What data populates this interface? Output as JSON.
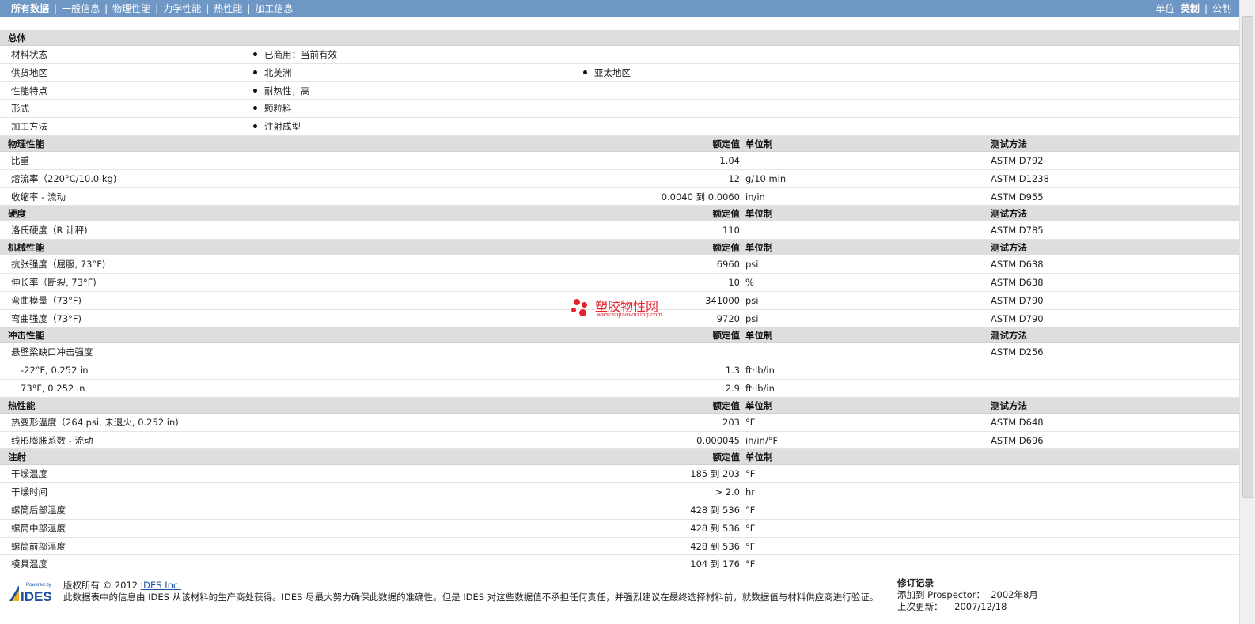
{
  "nav": {
    "tabs": [
      "所有数据",
      "一般信息",
      "物理性能",
      "力学性能",
      "热性能",
      "加工信息"
    ],
    "units_label": "单位",
    "unit_english": "英制",
    "unit_metric": "公制"
  },
  "headers": {
    "rated": "额定值",
    "unit": "单位制",
    "test": "测试方法"
  },
  "general": {
    "title": "总体",
    "rows": [
      {
        "name": "材料状态",
        "values": [
          "已商用：当前有效"
        ]
      },
      {
        "name": "供货地区",
        "values": [
          "北美洲",
          "亚太地区"
        ]
      },
      {
        "name": "性能特点",
        "values": [
          "耐热性，高"
        ]
      },
      {
        "name": "形式",
        "values": [
          "颗粒料"
        ]
      },
      {
        "name": "加工方法",
        "values": [
          "注射成型"
        ]
      }
    ]
  },
  "physical": {
    "title": "物理性能",
    "rows": [
      {
        "name": "比重",
        "value": "1.04",
        "unit": "",
        "test": "ASTM D792"
      },
      {
        "name": "熔流率（220°C/10.0 kg)",
        "value": "12",
        "unit": "g/10 min",
        "test": "ASTM D1238"
      },
      {
        "name": "收缩率 - 流动",
        "value": "0.0040 到  0.0060",
        "unit": "in/in",
        "test": "ASTM D955"
      }
    ]
  },
  "hardness": {
    "title": "硬度",
    "rows": [
      {
        "name": "洛氏硬度（R 计秤)",
        "value": "110",
        "unit": "",
        "test": "ASTM D785"
      }
    ]
  },
  "mechanical": {
    "title": "机械性能",
    "rows": [
      {
        "name": "抗张强度（屈服, 73°F)",
        "value": "6960",
        "unit": "psi",
        "test": "ASTM D638"
      },
      {
        "name": "伸长率（断裂, 73°F)",
        "value": "10",
        "unit": "%",
        "test": "ASTM D638"
      },
      {
        "name": "弯曲模量（73°F)",
        "value": "341000",
        "unit": "psi",
        "test": "ASTM D790"
      },
      {
        "name": "弯曲强度（73°F)",
        "value": "9720",
        "unit": "psi",
        "test": "ASTM D790"
      }
    ]
  },
  "impact": {
    "title": "冲击性能",
    "rows": [
      {
        "name": "悬壁梁缺口冲击强度",
        "value": "",
        "unit": "",
        "test": "ASTM D256",
        "sub": false
      },
      {
        "name": "-22°F, 0.252 in",
        "value": "1.3",
        "unit": "ft·lb/in",
        "test": "",
        "sub": true
      },
      {
        "name": "73°F, 0.252 in",
        "value": "2.9",
        "unit": "ft·lb/in",
        "test": "",
        "sub": true
      }
    ]
  },
  "thermal": {
    "title": "热性能",
    "rows": [
      {
        "name": "热变形温度（264 psi, 未退火, 0.252 in)",
        "value": "203",
        "unit": "°F",
        "test": "ASTM D648"
      },
      {
        "name": "线形膨胀系数 - 流动",
        "value": "0.000045",
        "unit": "in/in/°F",
        "test": "ASTM D696"
      }
    ]
  },
  "injection": {
    "title": "注射",
    "rows": [
      {
        "name": "干燥温度",
        "value": "185 到  203",
        "unit": "°F"
      },
      {
        "name": "干燥时间",
        "value": "> 2.0",
        "unit": "hr"
      },
      {
        "name": "螺筒后部温度",
        "value": "428 到  536",
        "unit": "°F"
      },
      {
        "name": "螺筒中部温度",
        "value": "428 到  536",
        "unit": "°F"
      },
      {
        "name": "螺筒前部温度",
        "value": "428 到  536",
        "unit": "°F"
      },
      {
        "name": "模具温度",
        "value": "104 到  176",
        "unit": "°F"
      }
    ]
  },
  "footer": {
    "logo_top": "Powered by",
    "logo_text": "IDES",
    "copyright_prefix": "版权所有 © 2012",
    "copyright_link": "IDES Inc.",
    "disclaimer": "此数据表中的信息由 IDES 从该材料的生产商处获得。IDES 尽最大努力确保此数据的准确性。但是 IDES 对这些数据值不承担任何责任，并强烈建议在最终选择材料前，就数据值与材料供应商进行验证。",
    "revision_title": "修订记录",
    "added_label": "添加到 Prospector：",
    "added_value": "2002年8月",
    "updated_label": "上次更新：",
    "updated_value": "2007/12/18"
  },
  "watermark": {
    "cn": "塑胶物性网",
    "en": "www.sujiaowuxing.com",
    "color": "#e8202a"
  },
  "colors": {
    "nav_bg": "#6f97c6",
    "section_bg": "#dedede"
  }
}
